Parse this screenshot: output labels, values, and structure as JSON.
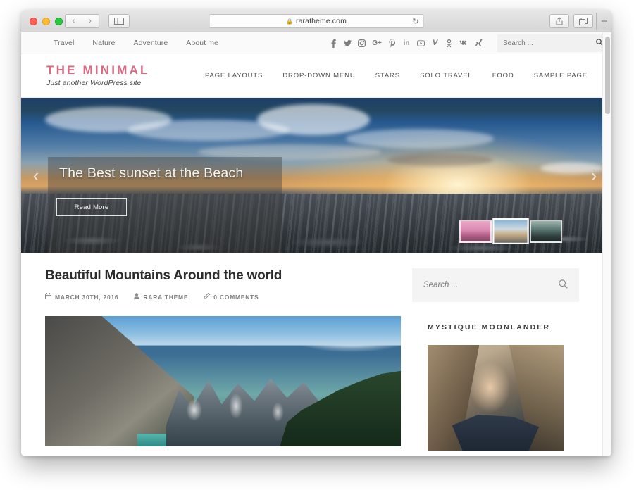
{
  "browser": {
    "traffic_lights": [
      "close",
      "minimize",
      "maximize"
    ],
    "back_label": "‹",
    "forward_label": "›",
    "sidebar_icon": "▥",
    "url": "raratheme.com",
    "lock_icon": "🔒",
    "reload_icon": "↻",
    "share_icon": "⇪",
    "tabs_icon": "❐",
    "newtab_label": "+"
  },
  "top_bar": {
    "menu": [
      {
        "label": "Travel"
      },
      {
        "label": "Nature"
      },
      {
        "label": "Adventure"
      },
      {
        "label": "About me"
      }
    ],
    "social": [
      {
        "name": "facebook-icon",
        "glyph": "f"
      },
      {
        "name": "twitter-icon",
        "glyph": "🐦"
      },
      {
        "name": "instagram-icon",
        "glyph": "▣"
      },
      {
        "name": "google-plus-icon",
        "glyph": "G+"
      },
      {
        "name": "pinterest-icon",
        "glyph": "P"
      },
      {
        "name": "linkedin-icon",
        "glyph": "in"
      },
      {
        "name": "youtube-icon",
        "glyph": "▶"
      },
      {
        "name": "vimeo-icon",
        "glyph": "V"
      },
      {
        "name": "odnoklassniki-icon",
        "glyph": "ok"
      },
      {
        "name": "vk-icon",
        "glyph": "vk"
      },
      {
        "name": "xing-icon",
        "glyph": "X"
      }
    ],
    "search_placeholder": "Search ...",
    "search_value": "",
    "search_icon": "search-icon"
  },
  "masthead": {
    "site_title": "THE MINIMAL",
    "tagline": "Just another WordPress site",
    "title_color": "#d96a83",
    "nav": [
      {
        "label": "PAGE LAYOUTS"
      },
      {
        "label": "DROP-DOWN MENU"
      },
      {
        "label": "STARS"
      },
      {
        "label": "SOLO TRAVEL"
      },
      {
        "label": "FOOD"
      },
      {
        "label": "SAMPLE PAGE"
      }
    ]
  },
  "hero": {
    "title": "The Best sunset at the Beach",
    "button_label": "Read More",
    "prev_label": "‹",
    "next_label": "›",
    "thumbnails": [
      {
        "name": "hero-thumbnail-1",
        "active": false
      },
      {
        "name": "hero-thumbnail-2",
        "active": true
      },
      {
        "name": "hero-thumbnail-3",
        "active": false
      }
    ]
  },
  "post": {
    "title": "Beautiful Mountains Around the world",
    "meta": {
      "date_icon": "calendar-icon",
      "date": "MARCH 30TH, 2016",
      "author_icon": "user-icon",
      "author": "RARA THEME",
      "comments_icon": "pencil-icon",
      "comments": "0 COMMENTS"
    }
  },
  "sidebar": {
    "search_placeholder": "Search ...",
    "search_value": "",
    "search_icon": "search-icon",
    "widget_title": "MYSTIQUE MOONLANDER"
  }
}
